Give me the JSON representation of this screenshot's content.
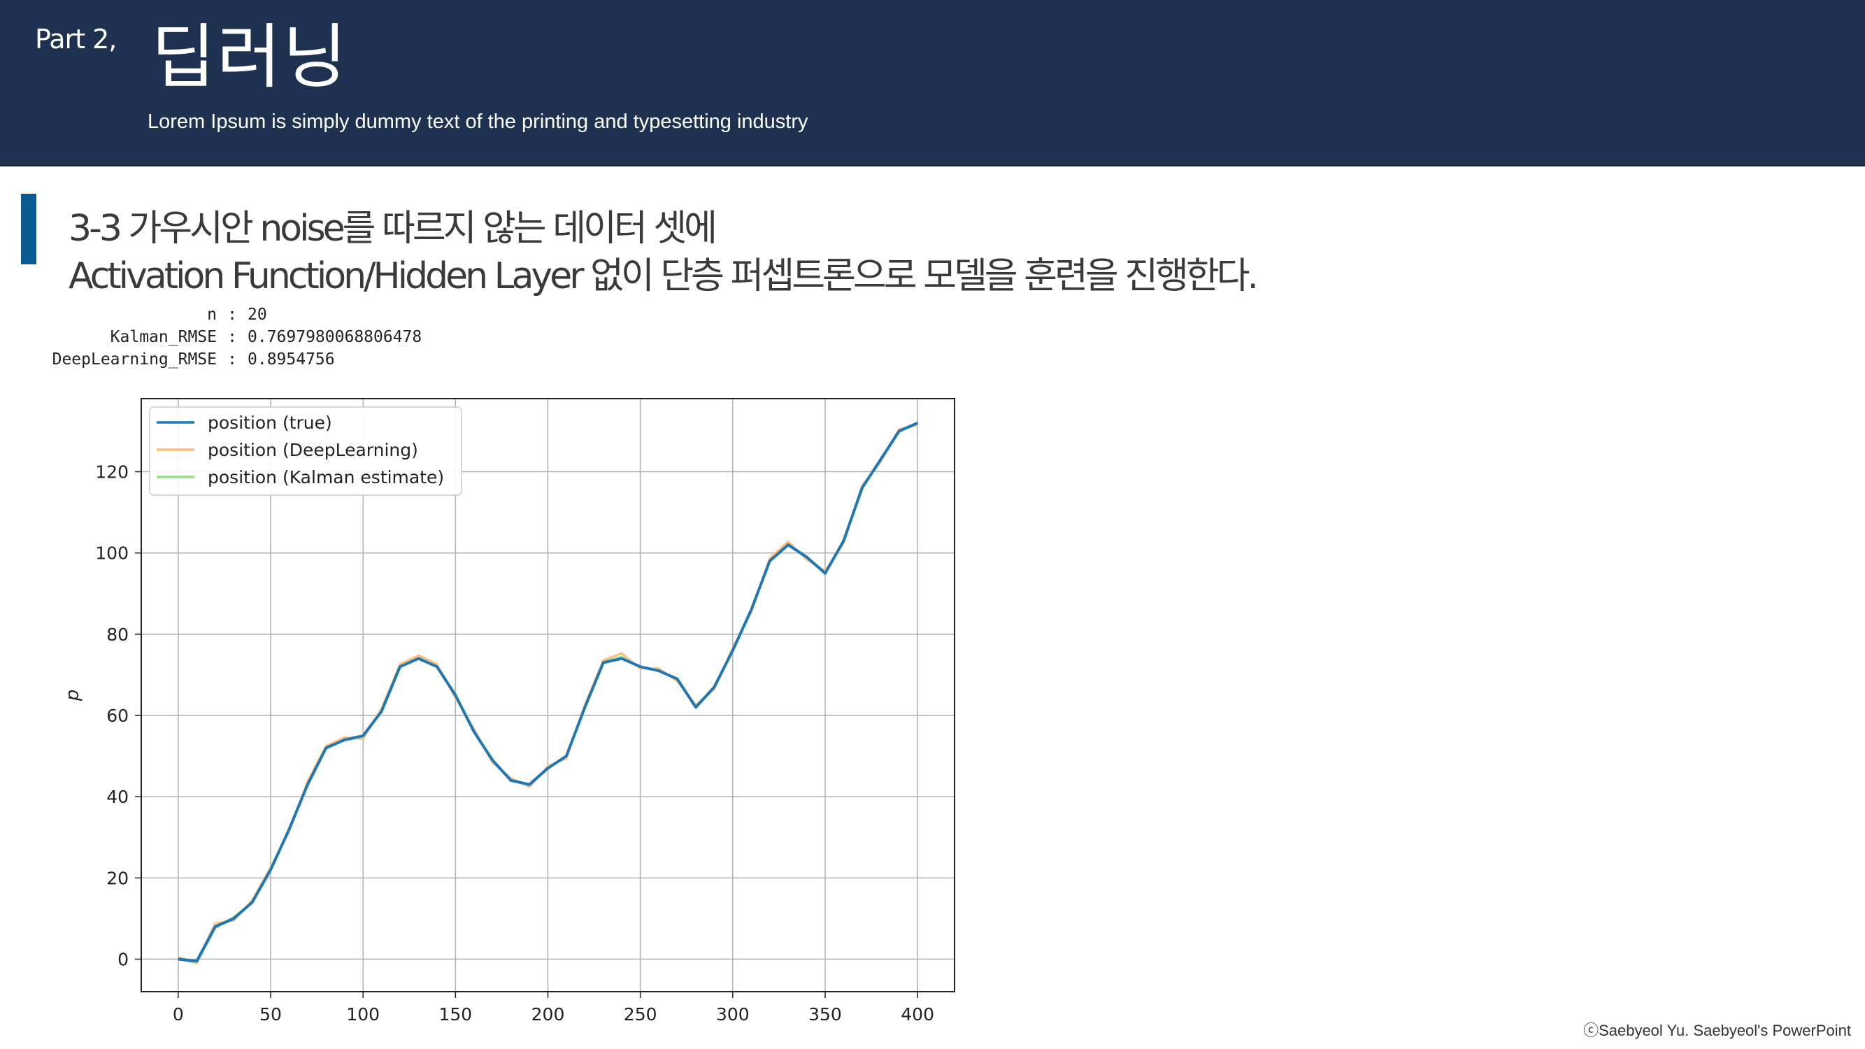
{
  "header": {
    "part_label": "Part 2,",
    "title": "딥러닝",
    "subtitle": "Lorem Ipsum is simply dummy text of the printing and typesetting industry"
  },
  "heading": {
    "line1": "3-3 가우시안 noise를 따르지 않는 데이터 셋에",
    "line2": "Activation Function/Hidden Layer 없이 단층 퍼셉트론으로 모델을 훈련을 진행한다."
  },
  "stats": [
    {
      "key": "n",
      "value": "20"
    },
    {
      "key": "Kalman_RMSE",
      "value": "0.7697980068806478"
    },
    {
      "key": "DeepLearning_RMSE",
      "value": "0.8954756"
    }
  ],
  "footer": "ⓒSaebyeol Yu. Saebyeol's PowerPoint",
  "colors": {
    "header_bg": "#1f3150",
    "accent": "#0a5a96",
    "true": "#1f77b4",
    "deeplearning": "#ffbb78",
    "kalman": "#98df8a"
  },
  "chart_data": {
    "type": "line",
    "title": "",
    "xlabel": "",
    "ylabel": "p",
    "xlim": [
      -20,
      420
    ],
    "ylim": [
      -8,
      138
    ],
    "xticks": [
      0,
      50,
      100,
      150,
      200,
      250,
      300,
      350,
      400
    ],
    "yticks": [
      0,
      20,
      40,
      60,
      80,
      100,
      120
    ],
    "grid": true,
    "legend_position": "upper-left",
    "x": [
      0,
      10,
      20,
      30,
      40,
      50,
      60,
      70,
      80,
      90,
      100,
      110,
      120,
      130,
      140,
      150,
      160,
      170,
      180,
      190,
      200,
      210,
      220,
      230,
      240,
      250,
      260,
      270,
      280,
      290,
      300,
      310,
      320,
      330,
      340,
      350,
      360,
      370,
      380,
      390,
      400
    ],
    "series": [
      {
        "name": "position (true)",
        "color": "#1f77b4",
        "values": [
          0,
          -0.5,
          8,
          10,
          14,
          22,
          32,
          43,
          52,
          54,
          55,
          61,
          72,
          74,
          72,
          65,
          56,
          49,
          44,
          43,
          47,
          50,
          62,
          73,
          74,
          72,
          71,
          69,
          62,
          67,
          76,
          86,
          98,
          102,
          99,
          95,
          103,
          116,
          123,
          130,
          132
        ]
      },
      {
        "name": "position (DeepLearning)",
        "color": "#ffbb78",
        "values": [
          0.5,
          -0.8,
          8.8,
          9.5,
          14.5,
          22.6,
          31.4,
          43.8,
          52.5,
          54.6,
          54.2,
          61.7,
          72.6,
          74.8,
          72.6,
          64.3,
          56.7,
          48.4,
          44.6,
          42.4,
          47.5,
          49.4,
          62.6,
          73.6,
          75.3,
          71.5,
          71.6,
          68.4,
          62.6,
          66.4,
          76.6,
          85.4,
          98.7,
          102.8,
          98.4,
          95.6,
          102.4,
          116.6,
          122.4,
          130.5,
          131.4
        ]
      },
      {
        "name": "position (Kalman estimate)",
        "color": "#98df8a",
        "values": [
          0,
          -1.0,
          7.6,
          10.4,
          13.8,
          22.2,
          31.8,
          43.5,
          52.2,
          53.9,
          54.6,
          61.4,
          72.3,
          74.3,
          72.4,
          64.8,
          56.4,
          48.7,
          44.3,
          42.8,
          47.3,
          49.8,
          62.3,
          73.3,
          74.5,
          71.8,
          71.3,
          68.7,
          62.3,
          66.8,
          76.3,
          85.7,
          98.4,
          102.4,
          98.7,
          95.3,
          102.7,
          116.3,
          122.7,
          130.2,
          131.7
        ]
      }
    ]
  }
}
